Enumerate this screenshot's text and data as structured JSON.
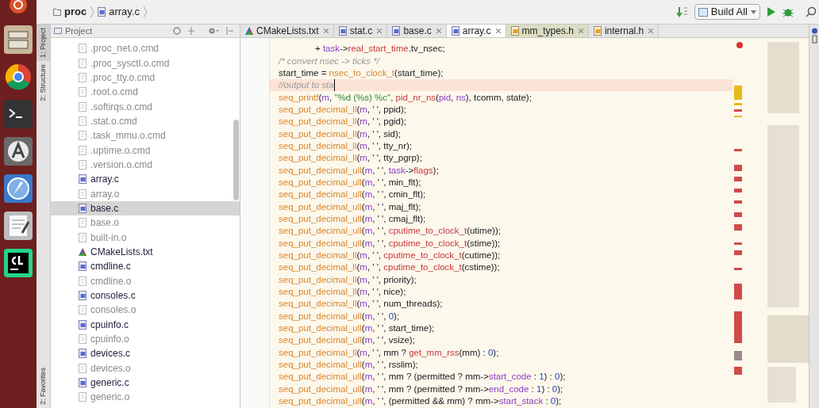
{
  "breadcrumb": [
    {
      "kind": "folder",
      "text": "proc"
    },
    {
      "kind": "c",
      "text": "array.c"
    }
  ],
  "toolbar": {
    "build_config": "Build All"
  },
  "tool_strip": [
    {
      "text": "1: Project",
      "selected": true
    },
    {
      "text": "2: Structure",
      "selected": false
    },
    {
      "text": "2: Favorites",
      "selected": false
    }
  ],
  "project_panel": {
    "title": "Project",
    "items": [
      {
        "kind": "cmd",
        "text": ".proc_net.o.cmd",
        "selected": false
      },
      {
        "kind": "cmd",
        "text": ".proc_sysctl.o.cmd",
        "selected": false
      },
      {
        "kind": "cmd",
        "text": ".proc_tty.o.cmd",
        "selected": false
      },
      {
        "kind": "cmd",
        "text": ".root.o.cmd",
        "selected": false
      },
      {
        "kind": "cmd",
        "text": ".softirqs.o.cmd",
        "selected": false
      },
      {
        "kind": "cmd",
        "text": ".stat.o.cmd",
        "selected": false
      },
      {
        "kind": "cmd",
        "text": ".task_mmu.o.cmd",
        "selected": false
      },
      {
        "kind": "cmd",
        "text": ".uptime.o.cmd",
        "selected": false
      },
      {
        "kind": "cmd",
        "text": ".version.o.cmd",
        "selected": false
      },
      {
        "kind": "c",
        "text": "array.c",
        "selected": false
      },
      {
        "kind": "o",
        "text": "array.o",
        "selected": false
      },
      {
        "kind": "c",
        "text": "base.c",
        "selected": true
      },
      {
        "kind": "o",
        "text": "base.o",
        "selected": false
      },
      {
        "kind": "o",
        "text": "built-in.o",
        "selected": false
      },
      {
        "kind": "cmake",
        "text": "CMakeLists.txt",
        "selected": false
      },
      {
        "kind": "c",
        "text": "cmdline.c",
        "selected": false
      },
      {
        "kind": "o",
        "text": "cmdline.o",
        "selected": false
      },
      {
        "kind": "c",
        "text": "consoles.c",
        "selected": false
      },
      {
        "kind": "o",
        "text": "consoles.o",
        "selected": false
      },
      {
        "kind": "c",
        "text": "cpuinfo.c",
        "selected": false
      },
      {
        "kind": "o",
        "text": "cpuinfo.o",
        "selected": false
      },
      {
        "kind": "c",
        "text": "devices.c",
        "selected": false
      },
      {
        "kind": "o",
        "text": "devices.o",
        "selected": false
      },
      {
        "kind": "c",
        "text": "generic.c",
        "selected": false
      },
      {
        "kind": "o",
        "text": "generic.o",
        "selected": false
      }
    ]
  },
  "tabs": [
    {
      "kind": "cmake",
      "text": "CMakeLists.txt",
      "selected": false
    },
    {
      "kind": "c",
      "text": "stat.c",
      "selected": false
    },
    {
      "kind": "c",
      "text": "base.c",
      "selected": false
    },
    {
      "kind": "c",
      "text": "array.c",
      "selected": true
    },
    {
      "kind": "h",
      "text": "mm_types.h",
      "selected": false
    },
    {
      "kind": "h",
      "text": "internal.h",
      "selected": false
    }
  ],
  "code": [
    {
      "indent": true,
      "current": false,
      "tokens": [
        {
          "kind": "plain",
          "text": "+ "
        },
        {
          "kind": "var",
          "text": "task"
        },
        {
          "kind": "plain",
          "text": "->"
        },
        {
          "kind": "func",
          "text": "real_start_time"
        },
        {
          "kind": "plain",
          "text": ".tv_nsec;"
        }
      ]
    },
    {
      "indent": false,
      "current": false,
      "tokens": [
        {
          "kind": "comment",
          "text": "/* convert nsec -> ticks */"
        }
      ]
    },
    {
      "indent": false,
      "current": false,
      "tokens": [
        {
          "kind": "plain",
          "text": "start_time = "
        },
        {
          "kind": "macro",
          "text": "nsec_to_clock_t"
        },
        {
          "kind": "plain",
          "text": "(start_time);"
        }
      ]
    },
    {
      "indent": false,
      "current": true,
      "tokens": [
        {
          "kind": "comment",
          "text": "//output to sta"
        }
      ]
    },
    {
      "indent": false,
      "current": false,
      "tokens": [
        {
          "kind": "macro",
          "text": "seq_printf"
        },
        {
          "kind": "plain",
          "text": "("
        },
        {
          "kind": "var",
          "text": "m"
        },
        {
          "kind": "plain",
          "text": ", "
        },
        {
          "kind": "string",
          "text": "\"%d (%s) %c\""
        },
        {
          "kind": "plain",
          "text": ", "
        },
        {
          "kind": "func",
          "text": "pid_nr_ns"
        },
        {
          "kind": "plain",
          "text": "("
        },
        {
          "kind": "var",
          "text": "pid"
        },
        {
          "kind": "plain",
          "text": ", "
        },
        {
          "kind": "var",
          "text": "ns"
        },
        {
          "kind": "plain",
          "text": "), tcomm, state);"
        }
      ]
    },
    {
      "indent": false,
      "current": false,
      "tokens": [
        {
          "kind": "macro",
          "text": "seq_put_decimal_ll"
        },
        {
          "kind": "plain",
          "text": "("
        },
        {
          "kind": "var",
          "text": "m"
        },
        {
          "kind": "plain",
          "text": ", ' ', ppid);"
        }
      ]
    },
    {
      "indent": false,
      "current": false,
      "tokens": [
        {
          "kind": "macro",
          "text": "seq_put_decimal_ll"
        },
        {
          "kind": "plain",
          "text": "("
        },
        {
          "kind": "var",
          "text": "m"
        },
        {
          "kind": "plain",
          "text": ", ' ', pgid);"
        }
      ]
    },
    {
      "indent": false,
      "current": false,
      "tokens": [
        {
          "kind": "macro",
          "text": "seq_put_decimal_ll"
        },
        {
          "kind": "plain",
          "text": "("
        },
        {
          "kind": "var",
          "text": "m"
        },
        {
          "kind": "plain",
          "text": ", ' ', sid);"
        }
      ]
    },
    {
      "indent": false,
      "current": false,
      "tokens": [
        {
          "kind": "macro",
          "text": "seq_put_decimal_ll"
        },
        {
          "kind": "plain",
          "text": "("
        },
        {
          "kind": "var",
          "text": "m"
        },
        {
          "kind": "plain",
          "text": ", ' ', tty_nr);"
        }
      ]
    },
    {
      "indent": false,
      "current": false,
      "tokens": [
        {
          "kind": "macro",
          "text": "seq_put_decimal_ll"
        },
        {
          "kind": "plain",
          "text": "("
        },
        {
          "kind": "var",
          "text": "m"
        },
        {
          "kind": "plain",
          "text": ", ' ', tty_pgrp);"
        }
      ]
    },
    {
      "indent": false,
      "current": false,
      "tokens": [
        {
          "kind": "macro",
          "text": "seq_put_decimal_ull"
        },
        {
          "kind": "plain",
          "text": "("
        },
        {
          "kind": "var",
          "text": "m"
        },
        {
          "kind": "plain",
          "text": ", ' ', "
        },
        {
          "kind": "var",
          "text": "task"
        },
        {
          "kind": "plain",
          "text": "->"
        },
        {
          "kind": "func",
          "text": "flags"
        },
        {
          "kind": "plain",
          "text": ");"
        }
      ]
    },
    {
      "indent": false,
      "current": false,
      "tokens": [
        {
          "kind": "macro",
          "text": "seq_put_decimal_ull"
        },
        {
          "kind": "plain",
          "text": "("
        },
        {
          "kind": "var",
          "text": "m"
        },
        {
          "kind": "plain",
          "text": ", ' ', min_flt);"
        }
      ]
    },
    {
      "indent": false,
      "current": false,
      "tokens": [
        {
          "kind": "macro",
          "text": "seq_put_decimal_ull"
        },
        {
          "kind": "plain",
          "text": "("
        },
        {
          "kind": "var",
          "text": "m"
        },
        {
          "kind": "plain",
          "text": ", ' ', cmin_flt);"
        }
      ]
    },
    {
      "indent": false,
      "current": false,
      "tokens": [
        {
          "kind": "macro",
          "text": "seq_put_decimal_ull"
        },
        {
          "kind": "plain",
          "text": "("
        },
        {
          "kind": "var",
          "text": "m"
        },
        {
          "kind": "plain",
          "text": ", ' ', maj_flt);"
        }
      ]
    },
    {
      "indent": false,
      "current": false,
      "tokens": [
        {
          "kind": "macro",
          "text": "seq_put_decimal_ull"
        },
        {
          "kind": "plain",
          "text": "("
        },
        {
          "kind": "var",
          "text": "m"
        },
        {
          "kind": "plain",
          "text": ", ' ', cmaj_flt);"
        }
      ]
    },
    {
      "indent": false,
      "current": false,
      "tokens": [
        {
          "kind": "macro",
          "text": "seq_put_decimal_ull"
        },
        {
          "kind": "plain",
          "text": "("
        },
        {
          "kind": "var",
          "text": "m"
        },
        {
          "kind": "plain",
          "text": ", ' ', "
        },
        {
          "kind": "func",
          "text": "cputime_to_clock_t"
        },
        {
          "kind": "plain",
          "text": "(utime));"
        }
      ]
    },
    {
      "indent": false,
      "current": false,
      "tokens": [
        {
          "kind": "macro",
          "text": "seq_put_decimal_ull"
        },
        {
          "kind": "plain",
          "text": "("
        },
        {
          "kind": "var",
          "text": "m"
        },
        {
          "kind": "plain",
          "text": ", ' ', "
        },
        {
          "kind": "func",
          "text": "cputime_to_clock_t"
        },
        {
          "kind": "plain",
          "text": "(stime));"
        }
      ]
    },
    {
      "indent": false,
      "current": false,
      "tokens": [
        {
          "kind": "macro",
          "text": "seq_put_decimal_ll"
        },
        {
          "kind": "plain",
          "text": "("
        },
        {
          "kind": "var",
          "text": "m"
        },
        {
          "kind": "plain",
          "text": ", ' ', "
        },
        {
          "kind": "func",
          "text": "cputime_to_clock_t"
        },
        {
          "kind": "plain",
          "text": "(cutime));"
        }
      ]
    },
    {
      "indent": false,
      "current": false,
      "tokens": [
        {
          "kind": "macro",
          "text": "seq_put_decimal_ll"
        },
        {
          "kind": "plain",
          "text": "("
        },
        {
          "kind": "var",
          "text": "m"
        },
        {
          "kind": "plain",
          "text": ", ' ', "
        },
        {
          "kind": "func",
          "text": "cputime_to_clock_t"
        },
        {
          "kind": "plain",
          "text": "(cstime));"
        }
      ]
    },
    {
      "indent": false,
      "current": false,
      "tokens": [
        {
          "kind": "macro",
          "text": "seq_put_decimal_ll"
        },
        {
          "kind": "plain",
          "text": "("
        },
        {
          "kind": "var",
          "text": "m"
        },
        {
          "kind": "plain",
          "text": ", ' ', priority);"
        }
      ]
    },
    {
      "indent": false,
      "current": false,
      "tokens": [
        {
          "kind": "macro",
          "text": "seq_put_decimal_ll"
        },
        {
          "kind": "plain",
          "text": "("
        },
        {
          "kind": "var",
          "text": "m"
        },
        {
          "kind": "plain",
          "text": ", ' ', nice);"
        }
      ]
    },
    {
      "indent": false,
      "current": false,
      "tokens": [
        {
          "kind": "macro",
          "text": "seq_put_decimal_ll"
        },
        {
          "kind": "plain",
          "text": "("
        },
        {
          "kind": "var",
          "text": "m"
        },
        {
          "kind": "plain",
          "text": ", ' ', num_threads);"
        }
      ]
    },
    {
      "indent": false,
      "current": false,
      "tokens": [
        {
          "kind": "macro",
          "text": "seq_put_decimal_ull"
        },
        {
          "kind": "plain",
          "text": "("
        },
        {
          "kind": "var",
          "text": "m"
        },
        {
          "kind": "plain",
          "text": ", ' ', "
        },
        {
          "kind": "number",
          "text": "0"
        },
        {
          "kind": "plain",
          "text": ");"
        }
      ]
    },
    {
      "indent": false,
      "current": false,
      "tokens": [
        {
          "kind": "macro",
          "text": "seq_put_decimal_ull"
        },
        {
          "kind": "plain",
          "text": "("
        },
        {
          "kind": "var",
          "text": "m"
        },
        {
          "kind": "plain",
          "text": ", ' ', start_time);"
        }
      ]
    },
    {
      "indent": false,
      "current": false,
      "tokens": [
        {
          "kind": "macro",
          "text": "seq_put_decimal_ull"
        },
        {
          "kind": "plain",
          "text": "("
        },
        {
          "kind": "var",
          "text": "m"
        },
        {
          "kind": "plain",
          "text": ", ' ', vsize);"
        }
      ]
    },
    {
      "indent": false,
      "current": false,
      "tokens": [
        {
          "kind": "macro",
          "text": "seq_put_decimal_ll"
        },
        {
          "kind": "plain",
          "text": "("
        },
        {
          "kind": "var",
          "text": "m"
        },
        {
          "kind": "plain",
          "text": ", ' ', mm ? "
        },
        {
          "kind": "func",
          "text": "get_mm_rss"
        },
        {
          "kind": "plain",
          "text": "(mm) : "
        },
        {
          "kind": "number",
          "text": "0"
        },
        {
          "kind": "plain",
          "text": ");"
        }
      ]
    },
    {
      "indent": false,
      "current": false,
      "tokens": [
        {
          "kind": "macro",
          "text": "seq_put_decimal_ull"
        },
        {
          "kind": "plain",
          "text": "("
        },
        {
          "kind": "var",
          "text": "m"
        },
        {
          "kind": "plain",
          "text": ", ' ', rsslim);"
        }
      ]
    },
    {
      "indent": false,
      "current": false,
      "tokens": [
        {
          "kind": "macro",
          "text": "seq_put_decimal_ull"
        },
        {
          "kind": "plain",
          "text": "("
        },
        {
          "kind": "var",
          "text": "m"
        },
        {
          "kind": "plain",
          "text": ", ' ', mm ? (permitted ? mm->"
        },
        {
          "kind": "var",
          "text": "start_code"
        },
        {
          "kind": "plain",
          "text": " : "
        },
        {
          "kind": "number",
          "text": "1"
        },
        {
          "kind": "plain",
          "text": ") : "
        },
        {
          "kind": "number",
          "text": "0"
        },
        {
          "kind": "plain",
          "text": ");"
        }
      ]
    },
    {
      "indent": false,
      "current": false,
      "tokens": [
        {
          "kind": "macro",
          "text": "seq_put_decimal_ull"
        },
        {
          "kind": "plain",
          "text": "("
        },
        {
          "kind": "var",
          "text": "m"
        },
        {
          "kind": "plain",
          "text": ", ' ', mm ? (permitted ? mm->"
        },
        {
          "kind": "var",
          "text": "end_code"
        },
        {
          "kind": "plain",
          "text": " : "
        },
        {
          "kind": "number",
          "text": "1"
        },
        {
          "kind": "plain",
          "text": ") : "
        },
        {
          "kind": "number",
          "text": "0"
        },
        {
          "kind": "plain",
          "text": ");"
        }
      ]
    },
    {
      "indent": false,
      "current": false,
      "tokens": [
        {
          "kind": "macro",
          "text": "seq_put_decimal_ull"
        },
        {
          "kind": "plain",
          "text": "("
        },
        {
          "kind": "var",
          "text": "m"
        },
        {
          "kind": "plain",
          "text": ", ' ', (permitted && mm) ? mm->"
        },
        {
          "kind": "var",
          "text": "start_stack"
        },
        {
          "kind": "plain",
          "text": " : "
        },
        {
          "kind": "number",
          "text": "0"
        },
        {
          "kind": "plain",
          "text": ");"
        }
      ]
    }
  ]
}
